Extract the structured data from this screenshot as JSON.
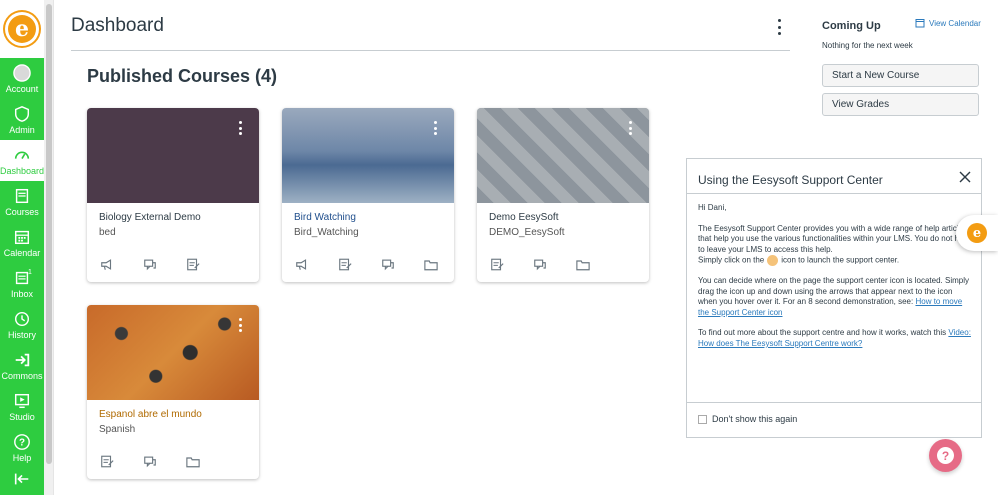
{
  "nav": {
    "logo_letter": "e",
    "items": [
      {
        "label": "Account",
        "icon": "account-icon"
      },
      {
        "label": "Admin",
        "icon": "admin-icon"
      },
      {
        "label": "Dashboard",
        "icon": "dashboard-icon"
      },
      {
        "label": "Courses",
        "icon": "courses-icon"
      },
      {
        "label": "Calendar",
        "icon": "calendar-icon"
      },
      {
        "label": "Inbox",
        "icon": "inbox-icon",
        "badge": "1"
      },
      {
        "label": "History",
        "icon": "history-icon"
      },
      {
        "label": "Commons",
        "icon": "commons-icon"
      },
      {
        "label": "Studio",
        "icon": "studio-icon"
      },
      {
        "label": "Help",
        "icon": "help-icon"
      }
    ],
    "collapse_icon": "collapse-arrow-icon"
  },
  "header": {
    "title": "Dashboard"
  },
  "section": {
    "title": "Published Courses (4)"
  },
  "courses": [
    {
      "name": "Biology External Demo",
      "code": "bed",
      "color": "#2d3b45"
    },
    {
      "name": "Bird Watching",
      "code": "Bird_Watching",
      "color": "#1f4e8c"
    },
    {
      "name": "Demo EesySoft",
      "code": "DEMO_EesySoft",
      "color": "#2d3b45"
    },
    {
      "name": "Espanol abre el mundo",
      "code": "Spanish",
      "color": "#b06a00"
    }
  ],
  "sidebar": {
    "coming_up": "Coming Up",
    "view_calendar": "View Calendar",
    "nothing": "Nothing for the next week",
    "start_course": "Start a New Course",
    "view_grades": "View Grades"
  },
  "support": {
    "title": "Using the Eesysoft Support Center",
    "greeting": "Hi Dani,",
    "p1": "The Eesysoft Support Center provides you with a wide range of help articles that help you use the various functionalities within your LMS. You do not have to leave your LMS to access this help.",
    "p1b_pre": "Simply click on the",
    "p1b_post": "icon to launch the support center.",
    "p2": "You can decide where on the page the support center icon is located. Simply drag the icon up and down using the arrows that appear next to the icon when you hover over it. For an 8 second demonstration, see:",
    "p2_link": "How to move the Support Center icon",
    "p3": "To find out more about the support centre and how it works, watch this",
    "p3_link": "Video: How does The Eesysoft Support Centre work?",
    "dont_show": "Don't show this again"
  }
}
